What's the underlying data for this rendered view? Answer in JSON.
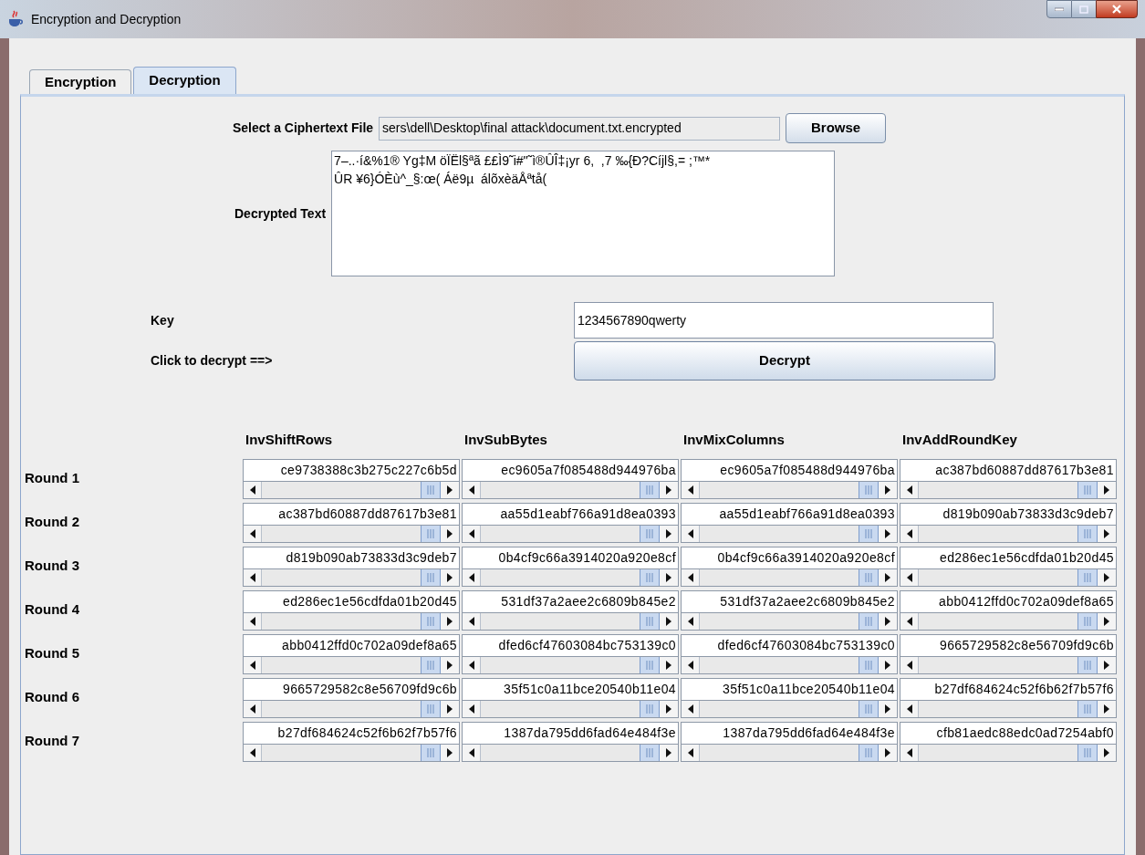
{
  "window": {
    "title": "Encryption and Decryption"
  },
  "tabs": [
    {
      "label": "Encryption",
      "selected": false
    },
    {
      "label": "Decryption",
      "selected": true
    }
  ],
  "file_row": {
    "label": "Select a Ciphertext File",
    "value": "sers\\dell\\Desktop\\final attack\\document.txt.encrypted",
    "button": "Browse"
  },
  "decrypted_text": {
    "label": "Decrypted Text",
    "value": "7–..·í&%1® Yg‡M öÏËl§ªã ££Ì9˜i#\"˜ì®ÛÎ‡¡yr 6,  ,7 ‰{Ð?Cíjl§,= ;™*\nÛR ¥6}ÓÈù^_§:œ( Áë9µ  álõxèäÅªtå("
  },
  "key": {
    "label": "Key",
    "value": "1234567890qwerty"
  },
  "decrypt": {
    "label": "Click to decrypt ==>",
    "button": "Decrypt"
  },
  "rounds_table": {
    "columns": [
      "InvShiftRows",
      "InvSubBytes",
      "InvMixColumns",
      "InvAddRoundKey"
    ],
    "rows": [
      {
        "label": "Round 1",
        "cells": [
          "ce9738388c3b275c227c6b5d",
          "ec9605a7f085488d944976ba",
          "ec9605a7f085488d944976ba",
          "ac387bd60887dd87617b3e81"
        ]
      },
      {
        "label": "Round 2",
        "cells": [
          "ac387bd60887dd87617b3e81",
          "aa55d1eabf766a91d8ea0393",
          "aa55d1eabf766a91d8ea0393",
          "d819b090ab73833d3c9deb7"
        ]
      },
      {
        "label": "Round 3",
        "cells": [
          "d819b090ab73833d3c9deb7",
          "0b4cf9c66a3914020a920e8cf",
          "0b4cf9c66a3914020a920e8cf",
          "ed286ec1e56cdfda01b20d45"
        ]
      },
      {
        "label": "Round 4",
        "cells": [
          "ed286ec1e56cdfda01b20d45",
          "531df37a2aee2c6809b845e2",
          "531df37a2aee2c6809b845e2",
          "abb0412ffd0c702a09def8a65"
        ]
      },
      {
        "label": "Round 5",
        "cells": [
          "abb0412ffd0c702a09def8a65",
          "dfed6cf47603084bc753139c0",
          "dfed6cf47603084bc753139c0",
          "9665729582c8e56709fd9c6b"
        ]
      },
      {
        "label": "Round 6",
        "cells": [
          "9665729582c8e56709fd9c6b",
          "35f51c0a11bce20540b11e04",
          "35f51c0a11bce20540b11e04",
          "b27df684624c52f6b62f7b57f6"
        ]
      },
      {
        "label": "Round 7",
        "cells": [
          "b27df684624c52f6b62f7b57f6",
          "1387da795dd6fad64e484f3e",
          "1387da795dd6fad64e484f3e",
          "cfb81aedc88edc0ad7254abf0"
        ]
      }
    ]
  }
}
